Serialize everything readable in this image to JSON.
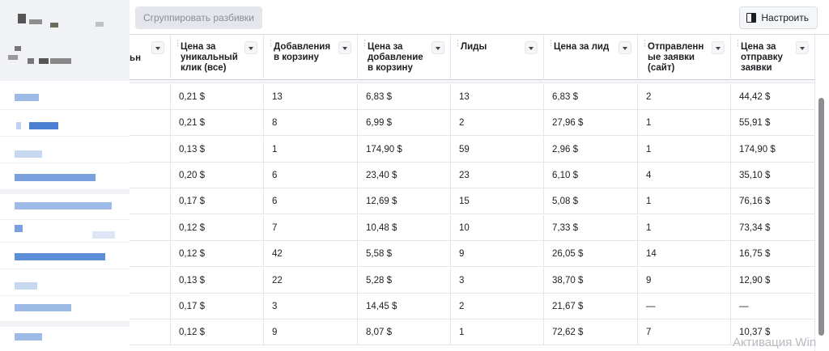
{
  "toolbar": {
    "group_breakdowns_label": "Сгруппировать разбивки",
    "settings_label": "Настроить"
  },
  "table": {
    "columns": [
      {
        "label": "ьн"
      },
      {
        "label": "Цена за уникальный клик (все)"
      },
      {
        "label": "Добавления в корзину"
      },
      {
        "label": "Цена за добавление в корзину"
      },
      {
        "label": "Лиды"
      },
      {
        "label": "Цена за лид"
      },
      {
        "label": "Отправленн ые заявки (сайт)"
      },
      {
        "label": "Цена за отправку заявки"
      }
    ],
    "rows": [
      [
        "0,21 $",
        "13",
        "6,83 $",
        "13",
        "6,83 $",
        "2",
        "44,42 $"
      ],
      [
        "0,21 $",
        "8",
        "6,99 $",
        "2",
        "27,96 $",
        "1",
        "55,91 $"
      ],
      [
        "0,13 $",
        "1",
        "174,90 $",
        "59",
        "2,96 $",
        "1",
        "174,90 $"
      ],
      [
        "0,20 $",
        "6",
        "23,40 $",
        "23",
        "6,10 $",
        "4",
        "35,10 $"
      ],
      [
        "0,17 $",
        "6",
        "12,69 $",
        "15",
        "5,08 $",
        "1",
        "76,16 $"
      ],
      [
        "0,12 $",
        "7",
        "10,48 $",
        "10",
        "7,33 $",
        "1",
        "73,34 $"
      ],
      [
        "0,12 $",
        "42",
        "5,58 $",
        "9",
        "26,05 $",
        "14",
        "16,75 $"
      ],
      [
        "0,13 $",
        "22",
        "5,28 $",
        "3",
        "38,70 $",
        "9",
        "12,90 $"
      ],
      [
        "0,17 $",
        "3",
        "14,45 $",
        "2",
        "21,67 $",
        "—",
        "—"
      ],
      [
        "0,12 $",
        "9",
        "8,07 $",
        "1",
        "72,62 $",
        "7",
        "10,37 $"
      ]
    ]
  },
  "watermark": "Активация Win",
  "colors": {
    "border": "#dadde1",
    "button_disabled": "#e4e6eb",
    "redaction_blue": "#4a7fd4"
  }
}
